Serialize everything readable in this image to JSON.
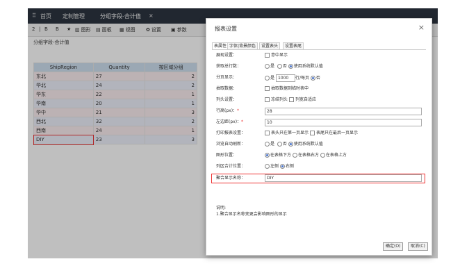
{
  "tabs": {
    "handle": "⠿",
    "home": "首页",
    "custom": "定制管理",
    "active": "分组字段-合计值",
    "close": "×"
  },
  "toolbar": {
    "items": [
      "图形",
      "面板",
      "视图",
      "设置",
      "参数"
    ],
    "icons": [
      "2",
      "|",
      "B",
      "B",
      "★"
    ]
  },
  "sheet": {
    "title": "分组字段-合计值",
    "columns": [
      "ShipRegion",
      "Quantity",
      "按区域分组"
    ],
    "rows": [
      {
        "region": "东北",
        "qty": "27",
        "group": "2"
      },
      {
        "region": "华北",
        "qty": "24",
        "group": "2"
      },
      {
        "region": "华东",
        "qty": "22",
        "group": "1"
      },
      {
        "region": "华南",
        "qty": "20",
        "group": "1"
      },
      {
        "region": "华中",
        "qty": "21",
        "group": "3"
      },
      {
        "region": "西北",
        "qty": "32",
        "group": "2"
      },
      {
        "region": "西南",
        "qty": "24",
        "group": "1"
      },
      {
        "region": "DIY",
        "qty": "23",
        "group": "3"
      }
    ]
  },
  "dialog": {
    "title": "报表设置",
    "close": "×",
    "tabs": [
      "表属性",
      "字体|背景颜色",
      "设置表头",
      "设置表尾"
    ],
    "fields": {
      "r1_label": "展现设置：",
      "r1_opt": "意中显示",
      "r2_label": "获取总行数：",
      "r2_a": "是",
      "r2_b": "否",
      "r2_c": "使用系统默认值",
      "r3_label": "分页显示：",
      "r3_a": "是",
      "r3_val": "1000",
      "r3_unit": "行/每页",
      "r3_b": "否",
      "r4_label": "抽取数据：",
      "r4_opt": "抽取数据到临时表中",
      "r5_label": "列头设置：",
      "r5_a": "冻结列头",
      "r5_b": "列宽自适应",
      "r6_label": "行高(px)：",
      "r6_val": "28",
      "r7_label": "左边距(px)：",
      "r7_val": "10",
      "r8_label": "打印报表设置：",
      "r8_a": "表头只在第一页显示",
      "r8_b": "表尾只在最后一页显示",
      "r9_label": "浏览自动刷新：",
      "r9_a": "是",
      "r9_b": "否",
      "r9_c": "使用系统默认值",
      "r10_label": "图形位置：",
      "r10_a": "在表格下方",
      "r10_b": "在表格右方",
      "r10_c": "在表格上方",
      "r11_label": "列区合计位置：",
      "r11_a": "左侧",
      "r11_b": "右侧",
      "r12_label": "聚合显示名称：",
      "r12_val": "DIY"
    },
    "note_title": "说明:",
    "note_text": "1.聚合显示名称变更会影响图形的显示",
    "ok": "确定(O)",
    "cancel": "取消(C)"
  }
}
